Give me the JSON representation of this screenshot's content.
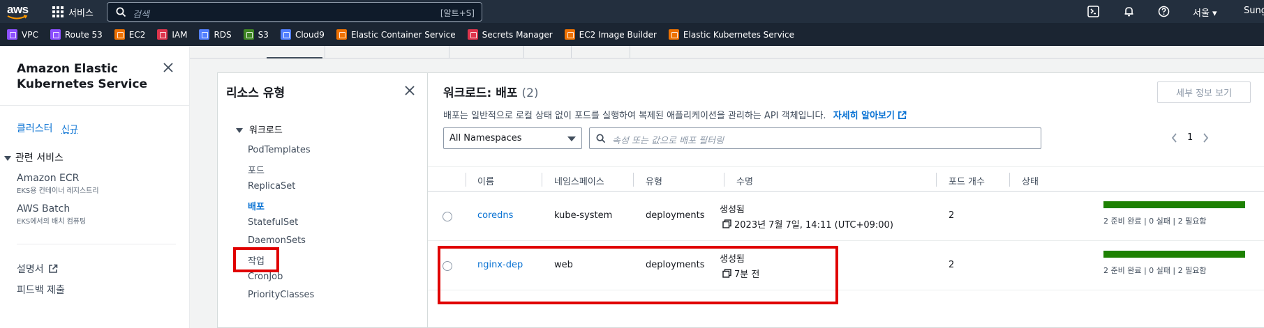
{
  "topnav": {
    "logo_text": "aws",
    "services_label": "서비스",
    "search_placeholder": "검색",
    "search_shortcut": "[알트+S]",
    "region": "서울 ▾",
    "user": "Sung"
  },
  "favorites": [
    {
      "label": "VPC",
      "color": "#8c4fff"
    },
    {
      "label": "Route 53",
      "color": "#8c4fff"
    },
    {
      "label": "EC2",
      "color": "#ed7100"
    },
    {
      "label": "IAM",
      "color": "#dd344c"
    },
    {
      "label": "RDS",
      "color": "#527fff"
    },
    {
      "label": "S3",
      "color": "#3f8624"
    },
    {
      "label": "Cloud9",
      "color": "#527fff"
    },
    {
      "label": "Elastic Container Service",
      "color": "#ed7100"
    },
    {
      "label": "Secrets Manager",
      "color": "#dd344c"
    },
    {
      "label": "EC2 Image Builder",
      "color": "#ed7100"
    },
    {
      "label": "Elastic Kubernetes Service",
      "color": "#ed7100"
    }
  ],
  "sidenav": {
    "title": "Amazon Elastic Kubernetes Service",
    "clusters": "클러스터",
    "new_badge": "신규",
    "related": "관련 서비스",
    "items": [
      {
        "label": "Amazon ECR",
        "sub": "EKS용 컨테이너 레지스트리"
      },
      {
        "label": "AWS Batch",
        "sub": "EKS에서의 배치 컴퓨팅"
      }
    ],
    "docs": "설명서",
    "feedback": "피드백 제출"
  },
  "resources": {
    "title": "리소스 유형",
    "group": "워크로드",
    "items": [
      "PodTemplates",
      "포드",
      "ReplicaSet",
      "배포",
      "StatefulSet",
      "DaemonSets",
      "작업",
      "CronJob",
      "PriorityClasses"
    ],
    "active": "배포"
  },
  "main": {
    "title": "워크로드: 배포",
    "count": "(2)",
    "details_button": "세부 정보 보기",
    "description": "배포는 일반적으로 로컬 상태 없이 포드를 실행하여 복제된 애플리케이션을 관리하는 API 객체입니다.",
    "learn_more": "자세히 알아보기",
    "namespace": "All Namespaces",
    "filter_placeholder": "속성 또는 값으로 배포 필터링",
    "page": "1",
    "columns": [
      "이름",
      "네임스페이스",
      "유형",
      "수명",
      "포드 개수",
      "상태"
    ],
    "rows": [
      {
        "name": "coredns",
        "namespace": "kube-system",
        "type": "deployments",
        "life_label": "생성됨",
        "life_value": "2023년 7월 7일, 14:11 (UTC+09:00)",
        "pods": "2",
        "status": "2 준비 완료 | 0 실패 | 2 필요함",
        "ready_fraction": 1.0
      },
      {
        "name": "nginx-dep",
        "namespace": "web",
        "type": "deployments",
        "life_label": "생성됨",
        "life_value": "7분 전",
        "pods": "2",
        "status": "2 준비 완료 | 0 실패 | 2 필요함",
        "ready_fraction": 1.0
      }
    ]
  },
  "colors": {
    "nav_bg": "#232f3e",
    "link": "#0972d3",
    "success": "#1d8102",
    "highlight": "#e00000"
  }
}
